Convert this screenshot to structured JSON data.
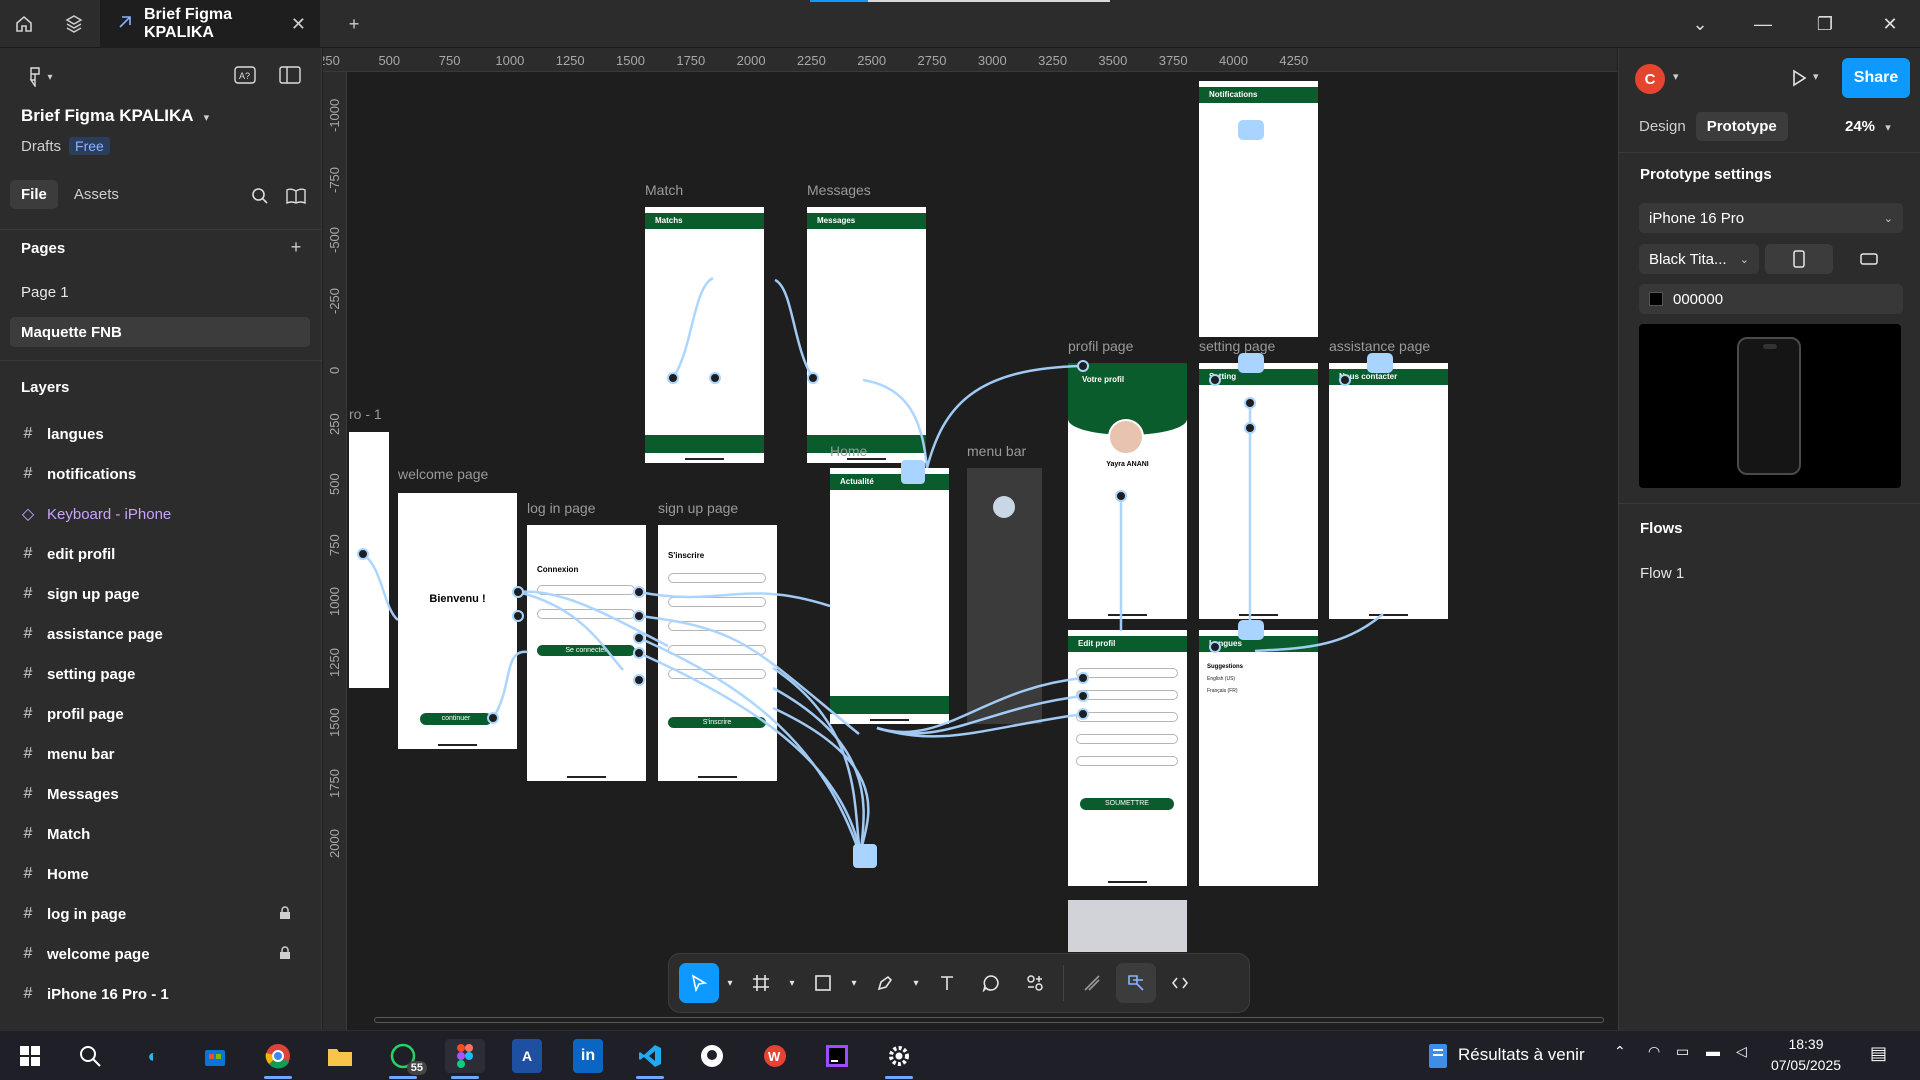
{
  "window": {
    "tab_title": "Brief Figma KPALIKA"
  },
  "left_panel": {
    "file_name": "Brief Figma KPALIKA",
    "location": "Drafts",
    "plan_badge": "Free",
    "tab_file": "File",
    "tab_assets": "Assets",
    "pages_title": "Pages",
    "pages": [
      "Page 1",
      "Maquette FNB"
    ],
    "layers_title": "Layers",
    "layers": [
      {
        "name": "langues",
        "kind": "frame",
        "locked": false
      },
      {
        "name": "notifications",
        "kind": "frame",
        "locked": false
      },
      {
        "name": "Keyboard - iPhone",
        "kind": "component",
        "locked": false
      },
      {
        "name": "edit profil",
        "kind": "frame",
        "locked": false
      },
      {
        "name": "sign up page",
        "kind": "frame",
        "locked": false
      },
      {
        "name": "assistance page",
        "kind": "frame",
        "locked": false
      },
      {
        "name": "setting page",
        "kind": "frame",
        "locked": false
      },
      {
        "name": "profil page",
        "kind": "frame",
        "locked": false
      },
      {
        "name": "menu bar",
        "kind": "frame",
        "locked": false
      },
      {
        "name": "Messages",
        "kind": "frame",
        "locked": false
      },
      {
        "name": "Match",
        "kind": "frame",
        "locked": false
      },
      {
        "name": "Home",
        "kind": "frame",
        "locked": false
      },
      {
        "name": "log in page",
        "kind": "frame",
        "locked": true
      },
      {
        "name": "welcome page",
        "kind": "frame",
        "locked": true
      },
      {
        "name": "iPhone 16 Pro - 1",
        "kind": "frame",
        "locked": false
      }
    ]
  },
  "rulers": {
    "horizontal": [
      "250",
      "500",
      "750",
      "1000",
      "1250",
      "1500",
      "1750",
      "2000",
      "2250",
      "2500",
      "2750",
      "3000",
      "3250",
      "3500",
      "3750",
      "4000",
      "4250"
    ],
    "vertical": [
      "-1000",
      "-750",
      "-500",
      "-250",
      "0",
      "250",
      "500",
      "750",
      "1000",
      "1250",
      "1500",
      "1750",
      "2000"
    ]
  },
  "canvas": {
    "frames": {
      "match": {
        "label": "Match",
        "header": "Matchs"
      },
      "messages": {
        "label": "Messages",
        "header": "Messages"
      },
      "notifications": {
        "header": "Notifications"
      },
      "home": {
        "label": "Home",
        "header": "Actualité"
      },
      "menu_bar": {
        "label": "menu bar"
      },
      "profil": {
        "label": "profil page",
        "header": "Votre profil",
        "user": "Yayra ANANI"
      },
      "setting": {
        "label": "setting page",
        "header": "Setting"
      },
      "assistance": {
        "label": "assistance page",
        "header": "Nous contacter"
      },
      "welcome": {
        "label": "welcome page",
        "title": "Bienvenu !",
        "button": "continuer"
      },
      "login": {
        "label": "log in page",
        "title": "Connexion",
        "button": "Se connecter"
      },
      "signup": {
        "label": "sign up page",
        "title": "S'inscrire",
        "button": "S'inscrire"
      },
      "edit_profil": {
        "header": "Edit profil",
        "button": "SOUMETTRE"
      },
      "langues": {
        "header": "Langues",
        "subtitle": "Suggestions",
        "opt1": "English (US)",
        "opt2": "Français (FR)"
      },
      "iphone": {
        "label": "ro - 1"
      }
    }
  },
  "right_panel": {
    "avatar_initial": "C",
    "share_label": "Share",
    "tab_design": "Design",
    "tab_prototype": "Prototype",
    "zoom": "24%",
    "prototype_settings_title": "Prototype settings",
    "device": "iPhone 16 Pro",
    "device_color": "Black Tita...",
    "background_hex": "000000",
    "flows_title": "Flows",
    "flows": [
      "Flow 1"
    ]
  },
  "taskbar": {
    "weather_text": "Résultats à venir",
    "time": "18:39",
    "date": "07/05/2025",
    "whatsapp_badge": "55"
  },
  "colors": {
    "accent": "#0d99ff",
    "brand_green": "#0a5c2c",
    "wire": "#a8d4ff"
  }
}
